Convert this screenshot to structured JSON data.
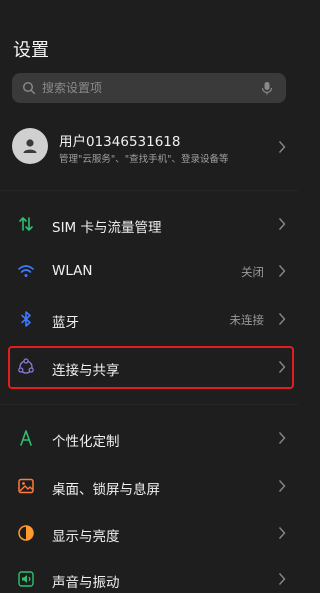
{
  "header": {
    "title": "设置"
  },
  "search": {
    "placeholder": "搜索设置项"
  },
  "account": {
    "name": "用户01346531618",
    "subtitle": "管理\"云服务\"、\"查找手机\"、登录设备等"
  },
  "items": [
    {
      "label": "SIM 卡与流量管理",
      "value": "",
      "icon": "sim-arrows-icon",
      "color": "#2fbf71"
    },
    {
      "label": "WLAN",
      "value": "关闭",
      "icon": "wifi-icon",
      "color": "#3d7bff"
    },
    {
      "label": "蓝牙",
      "value": "未连接",
      "icon": "bluetooth-icon",
      "color": "#3d7bff"
    },
    {
      "label": "连接与共享",
      "value": "",
      "icon": "share-nodes-icon",
      "color": "#8a7bd6",
      "highlighted": true
    },
    {
      "label": "个性化定制",
      "value": "",
      "icon": "personalize-icon",
      "color": "#2fbf71"
    },
    {
      "label": "桌面、锁屏与息屏",
      "value": "",
      "icon": "picture-icon",
      "color": "#ff7a3d"
    },
    {
      "label": "显示与亮度",
      "value": "",
      "icon": "brightness-icon",
      "color": "#ff9a2d"
    },
    {
      "label": "声音与振动",
      "value": "",
      "icon": "speaker-icon",
      "color": "#2fbf71"
    }
  ]
}
